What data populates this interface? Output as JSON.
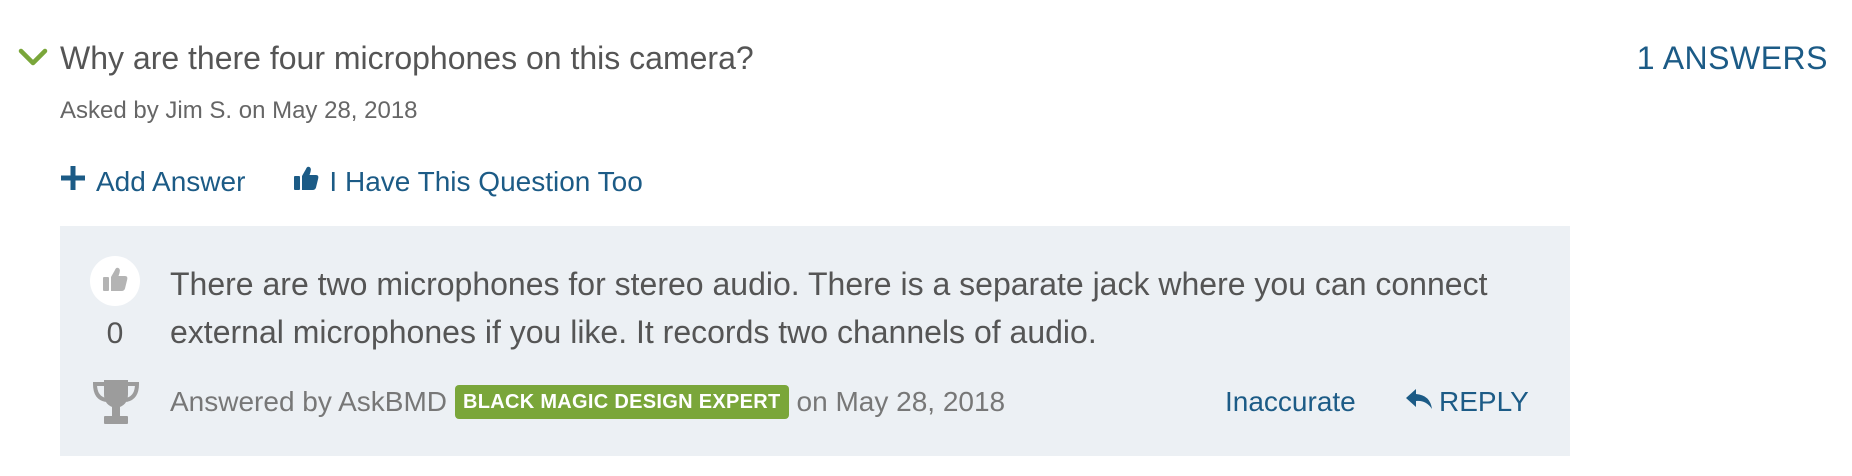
{
  "question": {
    "title": "Why are there four microphones on this camera?",
    "asked_by": "Asked by Jim S. on May 28, 2018",
    "answers_count": "1 ANSWERS",
    "expand_icon": "chevron-down-icon"
  },
  "actions": {
    "add_answer": "Add Answer",
    "add_answer_icon": "plus-icon",
    "same_question": "I Have This Question Too",
    "same_question_icon": "thumbs-up-icon"
  },
  "answer": {
    "votes": "0",
    "vote_icon": "thumbs-up-icon",
    "expert_icon": "trophy-icon",
    "text": "There are two microphones for stereo audio. There is a separate jack where you can connect external microphones if you like. It records two channels of audio.",
    "answered_by": "Answered by AskBMD",
    "badge": "BLACK MAGIC DESIGN EXPERT",
    "date": "on May 28, 2018",
    "inaccurate": "Inaccurate",
    "reply": "REPLY",
    "reply_icon": "reply-arrow-icon"
  },
  "colors": {
    "link": "#1c5b86",
    "accent_green": "#7aa63a",
    "answer_background": "#ecf0f4",
    "text": "#555555"
  }
}
